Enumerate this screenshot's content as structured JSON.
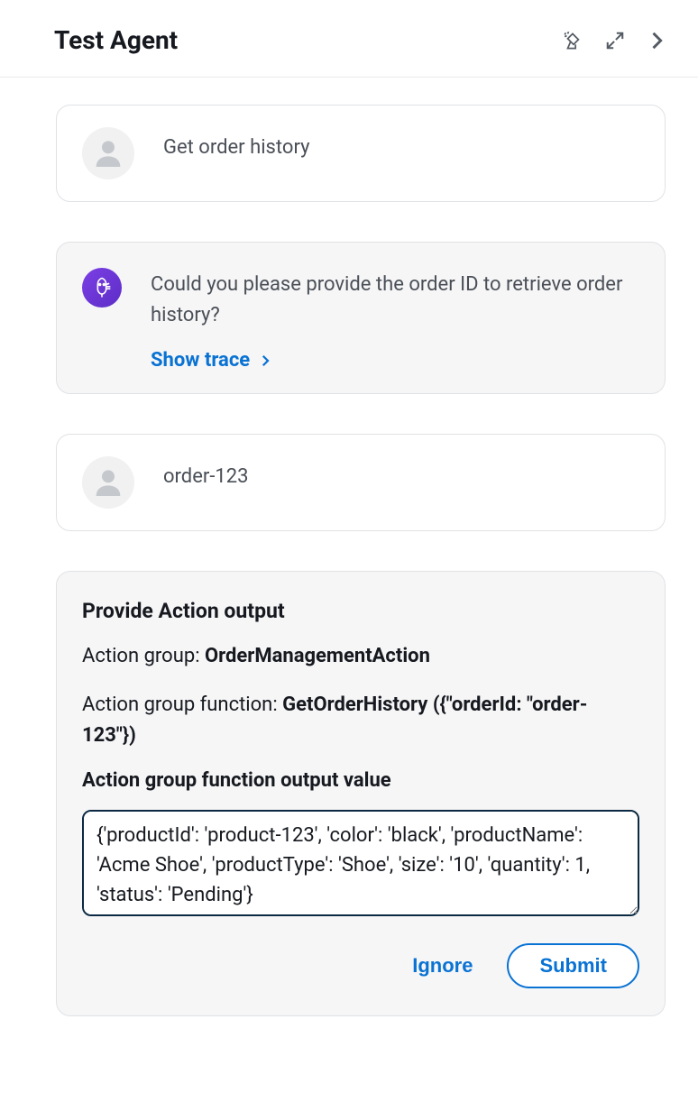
{
  "header": {
    "title": "Test Agent"
  },
  "messages": [
    {
      "role": "user",
      "text": "Get order history"
    },
    {
      "role": "agent",
      "text": "Could you please provide the order ID to retrieve order history?",
      "show_trace_label": "Show trace"
    },
    {
      "role": "user",
      "text": "order-123"
    }
  ],
  "action_output": {
    "title": "Provide Action output",
    "group_label": "Action group:",
    "group_value": "OrderManagementAction",
    "function_label": "Action group function:",
    "function_value": "GetOrderHistory ({\"orderId: \"order-123\"})",
    "output_value_label": "Action group function output value",
    "output_value": "{'productId': 'product-123', 'color': 'black', 'productName': 'Acme Shoe', 'productType': 'Shoe', 'size': '10', 'quantity': 1, 'status': 'Pending'}",
    "ignore_label": "Ignore",
    "submit_label": "Submit"
  }
}
